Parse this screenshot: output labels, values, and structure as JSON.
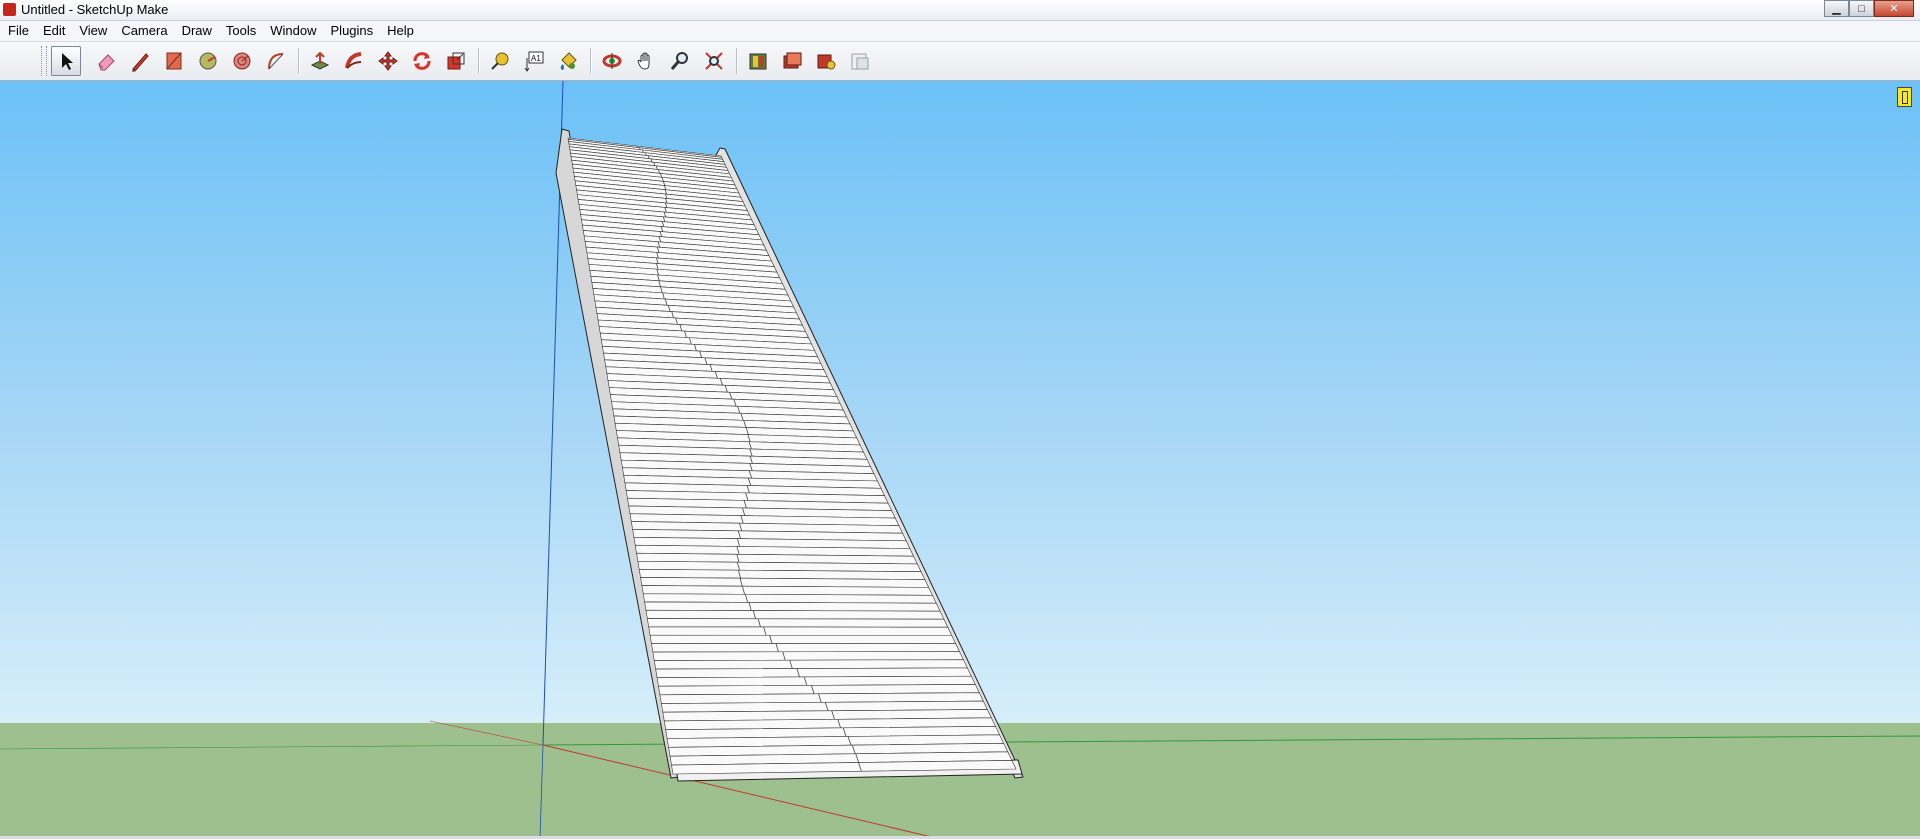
{
  "window": {
    "title": "Untitled - SketchUp Make",
    "controls": {
      "minimize": "▁",
      "maximize": "□",
      "close": "✕"
    }
  },
  "menu": [
    "File",
    "Edit",
    "View",
    "Camera",
    "Draw",
    "Tools",
    "Window",
    "Plugins",
    "Help"
  ],
  "toolbar": {
    "tools": [
      {
        "name": "select-icon",
        "active": true
      },
      {
        "name": "eraser-icon"
      },
      {
        "name": "pencil-line-icon"
      },
      {
        "name": "rectangle-icon"
      },
      {
        "name": "circle-icon"
      },
      {
        "name": "polygon-icon"
      },
      {
        "name": "arc-icon"
      },
      {
        "name": "push-pull-icon"
      },
      {
        "name": "follow-me-icon"
      },
      {
        "name": "move-icon"
      },
      {
        "name": "rotate-icon"
      },
      {
        "name": "scale-icon"
      },
      {
        "name": "tape-measure-icon"
      },
      {
        "name": "text-icon"
      },
      {
        "name": "paint-bucket-icon"
      },
      {
        "name": "orbit-icon"
      },
      {
        "name": "pan-icon"
      },
      {
        "name": "zoom-icon"
      },
      {
        "name": "zoom-extents-icon"
      },
      {
        "name": "get-models-icon"
      },
      {
        "name": "share-model-icon"
      },
      {
        "name": "extension-warehouse-icon"
      },
      {
        "name": "send-to-layout-icon"
      }
    ]
  },
  "colors": {
    "sky_top": "#6cc1f7",
    "sky_bottom": "#d6eefa",
    "ground": "#9ebf8e",
    "axis_red": "#c0392b",
    "axis_green": "#2e9b3a",
    "axis_blue": "#1f4fb0"
  },
  "model": {
    "subject": "staircase",
    "step_count": 96
  }
}
